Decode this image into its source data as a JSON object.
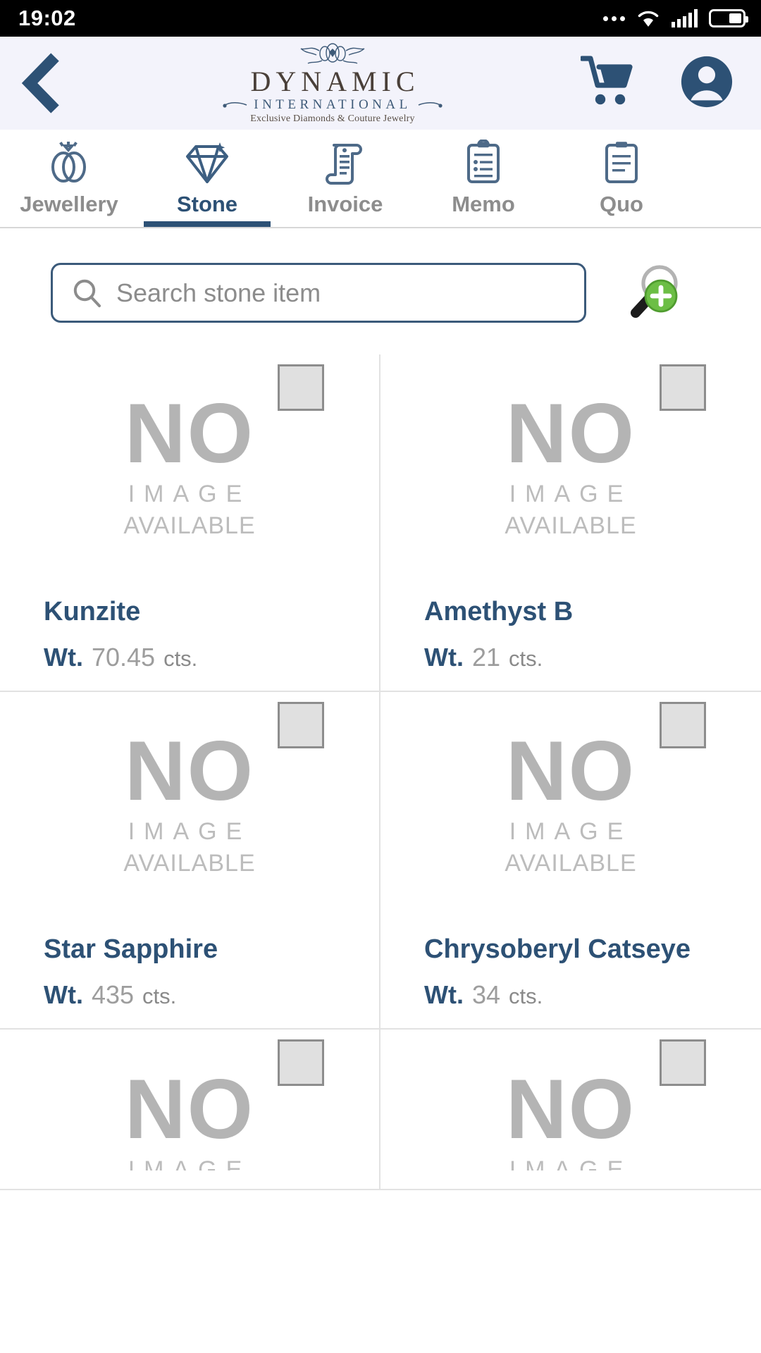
{
  "statusbar": {
    "time": "19:02",
    "icons": [
      "more-dots",
      "wifi",
      "signal",
      "battery"
    ]
  },
  "header": {
    "back_icon": "back-chevron-icon",
    "logo_name": "DYNAMIC",
    "logo_subtitle": "INTERNATIONAL",
    "logo_tagline": "Exclusive Diamonds & Couture Jewelry",
    "cart_icon": "shopping-cart-icon",
    "account_icon": "account-circle-icon",
    "background": "#f3f3fb",
    "accent": "#2d5175"
  },
  "tabs": [
    {
      "label": "Jewellery",
      "icon": "rings-icon",
      "active": false
    },
    {
      "label": "Stone",
      "icon": "diamond-icon",
      "active": true
    },
    {
      "label": "Invoice",
      "icon": "receipt-icon",
      "active": false
    },
    {
      "label": "Memo",
      "icon": "clipboard-icon",
      "active": false
    },
    {
      "label": "Quo",
      "icon": "clipboard-icon",
      "active": false
    }
  ],
  "search": {
    "placeholder": "Search stone item",
    "value": "",
    "icon": "search-icon",
    "advanced_icon": "advanced-search-add-icon"
  },
  "placeholder_image": {
    "line1": "NO",
    "line2": "IMAGE",
    "line3": "AVAILABLE"
  },
  "weight_label": "Wt.",
  "weight_unit": "cts.",
  "items": [
    {
      "name": "Kunzite",
      "weight": "70.45",
      "selected": false
    },
    {
      "name": "Amethyst B",
      "weight": "21",
      "selected": false
    },
    {
      "name": "Star Sapphire",
      "weight": "435",
      "selected": false
    },
    {
      "name": "Chrysoberyl Catseye",
      "weight": "34",
      "selected": false
    },
    {
      "name": "",
      "weight": "",
      "selected": false
    },
    {
      "name": "",
      "weight": "",
      "selected": false
    }
  ]
}
